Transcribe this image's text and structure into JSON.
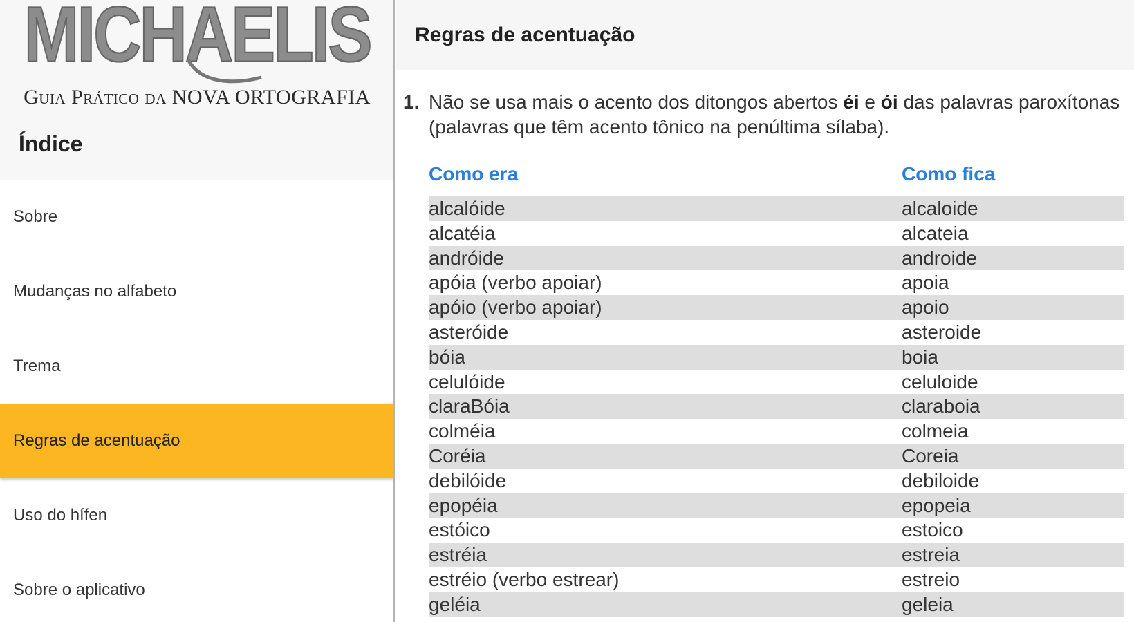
{
  "brand": {
    "logo_text": "MICHAELIS",
    "subtitle": "Guia Prático da NOVA ORTOGRAFIA"
  },
  "sidebar": {
    "title": "Índice",
    "items": [
      {
        "label": "Sobre"
      },
      {
        "label": "Mudanças no alfabeto"
      },
      {
        "label": "Trema"
      },
      {
        "label": "Regras de acentuação"
      },
      {
        "label": "Uso do hífen"
      },
      {
        "label": "Sobre o aplicativo"
      }
    ],
    "active_index": 3
  },
  "main": {
    "title": "Regras de acentuação",
    "rule": {
      "number": "1.",
      "text_before": "Não se usa mais o acento dos ditongos abertos ",
      "bold1": "éi",
      "text_mid": " e ",
      "bold2": "ói",
      "text_after": " das palavras paroxítonas (palavras que têm acento tônico na penúltima sílaba)."
    },
    "table": {
      "col_before": "Como era",
      "col_after": "Como fica",
      "rows": [
        {
          "before": "alcalóide",
          "after": "alcaloide"
        },
        {
          "before": "alcatéia",
          "after": "alcateia"
        },
        {
          "before": "andróide",
          "after": "androide"
        },
        {
          "before": "apóia (verbo apoiar)",
          "after": "apoia"
        },
        {
          "before": "apóio (verbo apoiar)",
          "after": "apoio"
        },
        {
          "before": "asteróide",
          "after": "asteroide"
        },
        {
          "before": "bóia",
          "after": "boia"
        },
        {
          "before": "celulóide",
          "after": "celuloide"
        },
        {
          "before": "claraBóia",
          "after": "claraboia"
        },
        {
          "before": "colméia",
          "after": "colmeia"
        },
        {
          "before": "Coréia",
          "after": "Coreia"
        },
        {
          "before": "debilóide",
          "after": "debiloide"
        },
        {
          "before": "epopéia",
          "after": "epopeia"
        },
        {
          "before": "estóico",
          "after": "estoico"
        },
        {
          "before": "estréia",
          "after": "estreia"
        },
        {
          "before": "estréio (verbo estrear)",
          "after": "estreio"
        },
        {
          "before": "geléia",
          "after": "geleia"
        }
      ]
    }
  },
  "colors": {
    "accent": "#fbb622",
    "link_blue": "#2b7fd6",
    "stripe": "#dedede"
  }
}
